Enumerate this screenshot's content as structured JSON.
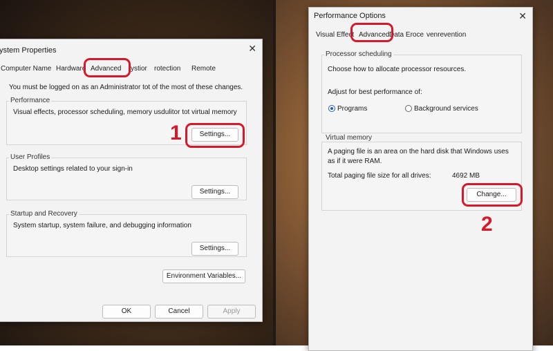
{
  "left": {
    "title": "ystem Properties",
    "tabs": [
      "Computer Name",
      "Hardware",
      "Advanced",
      "ystior",
      "rotection",
      "Remote"
    ],
    "admin_note": "You must be logged on as an Administrator tot of the most of these changes.",
    "performance": {
      "title": "Performance",
      "desc": "Visual effects, processor scheduling, memory usdulitor tot virtual memory",
      "button": "Settings..."
    },
    "user_profiles": {
      "title": "User Profiles",
      "desc": "Desktop settings related to your sign-in",
      "button": "Settings..."
    },
    "startup": {
      "title": "Startup and Recovery",
      "desc": "System startup, system failure, and debugging information",
      "button": "Settings..."
    },
    "env_button": "Environment Variables...",
    "ok": "OK",
    "cancel": "Cancel",
    "apply": "Apply",
    "marker": "1"
  },
  "right": {
    "title": "Performance Options",
    "tabs": [
      "Visual Effect",
      "Advanced",
      "Data Eroce",
      "venrevention"
    ],
    "processor": {
      "title": "Processor scheduling",
      "desc": "Choose how to allocate processor resources.",
      "adjust": "Adjust for best performance of:",
      "programs": "Programs",
      "background": "Background services",
      "selected": "Programs"
    },
    "virtual_memory": {
      "title": "Virtual memory",
      "line1": "A paging file is an area on the hard disk that Windows uses",
      "line2": "as if it were RAM.",
      "total_label": "Total paging file size for all drives:",
      "total_value": "4692 MB",
      "button": "Change..."
    },
    "marker": "2"
  },
  "colors": {
    "highlight": "#d7182a",
    "radio_selected": "#1f5bc4"
  },
  "icons": {
    "close": "close-icon"
  }
}
